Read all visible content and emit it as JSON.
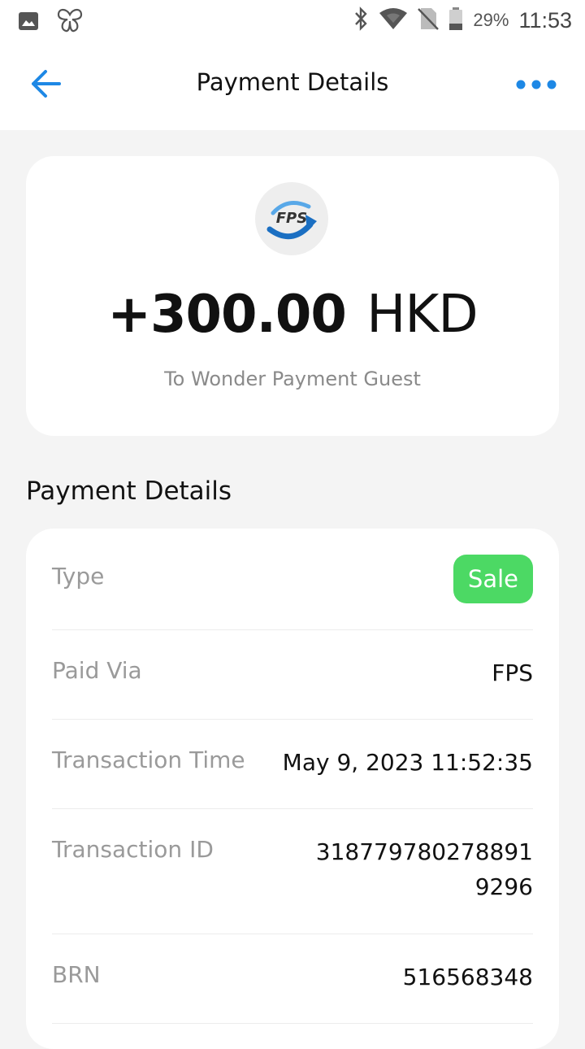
{
  "status_bar": {
    "left_icons": [
      "image-icon",
      "butterfly-icon"
    ],
    "right_icons": [
      "bluetooth-icon",
      "wifi-icon",
      "no-sim-icon",
      "battery-icon"
    ],
    "battery_percent": "29%",
    "time": "11:53"
  },
  "app_bar": {
    "title": "Payment Details",
    "back_icon": "arrow-left-icon",
    "more_icon": "more-horizontal-icon",
    "accent_color": "#1e88e5"
  },
  "summary": {
    "logo_text": "FPS",
    "amount": "+300.00",
    "currency": "HKD",
    "recipient": "To Wonder Payment Guest"
  },
  "details": {
    "section_title": "Payment Details",
    "rows": [
      {
        "label": "Type",
        "value": "Sale",
        "badge_color": "#4cd964"
      },
      {
        "label": "Paid Via",
        "value": "FPS"
      },
      {
        "label": "Transaction Time",
        "value": "May 9, 2023 11:52:35"
      },
      {
        "label": "Transaction ID",
        "value_line1": "318779780278891",
        "value_line2": "9296"
      },
      {
        "label": "BRN",
        "value": "516568348"
      }
    ]
  }
}
